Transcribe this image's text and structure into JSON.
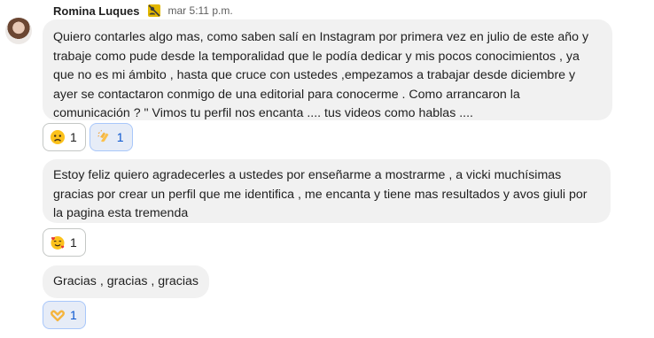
{
  "message": {
    "sender_name": "Romina Luques",
    "timestamp": "mar 5:11 p.m."
  },
  "bubbles": [
    {
      "lines": [
        "Quiero contarles algo mas, como saben salí en Instagram por primera vez en julio de este año y",
        "trabaje como pude desde la temporalidad que le podía dedicar y mis pocos  conocimientos , ya",
        "que no es mi ámbito , hasta que cruce con ustedes ,empezamos a trabajar desde diciembre y",
        "ayer se contactaron conmigo de una editorial para conocerme . Como arrancaron la",
        "comunicación ?  \" Vimos tu perfil nos encanta .... tus videos como hablas ...."
      ],
      "reactions": [
        {
          "emoji": "worried-face",
          "count": "1",
          "active": false
        },
        {
          "emoji": "clapping-hands",
          "count": "1",
          "active": true
        }
      ]
    },
    {
      "lines": [
        "Estoy feliz quiero agradecerles a ustedes por enseñarme a mostrarme , a vicki muchísimas",
        "gracias por crear un perfil que me identifica , me encanta y tiene mas resultados y avos giuli por",
        "la pagina esta tremenda"
      ],
      "reactions": [
        {
          "emoji": "smiling-face-with-hearts",
          "count": "1",
          "active": false
        }
      ]
    },
    {
      "lines": [
        "Gracias , gracias , gracias"
      ],
      "reactions": [
        {
          "emoji": "heart-hands",
          "count": "1",
          "active": true
        }
      ]
    }
  ],
  "colors": {
    "bubble_bg": "#f1f1f1",
    "active_chip_bg": "#e6ecf7",
    "active_chip_text": "#0b57d0"
  }
}
